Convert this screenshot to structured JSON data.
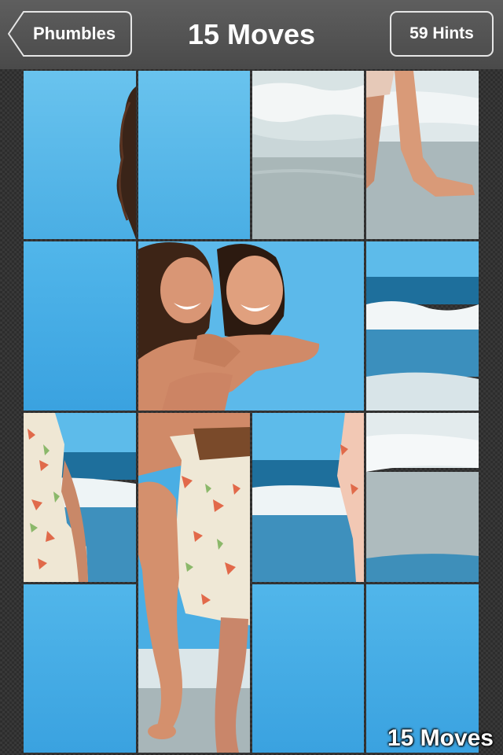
{
  "navbar": {
    "back_label": "Phumbles",
    "title": "15 Moves",
    "hints_label": "59 Hints"
  },
  "puzzle": {
    "grid_columns": 4,
    "grid_rows": 4,
    "moves_overlay": "15 Moves"
  },
  "colors": {
    "navbar": "#555555",
    "sky": "#5bbbeb",
    "sea": "#1f7fb0",
    "sand": "#a6b6bb",
    "tile_border": "#1a1a1a"
  }
}
